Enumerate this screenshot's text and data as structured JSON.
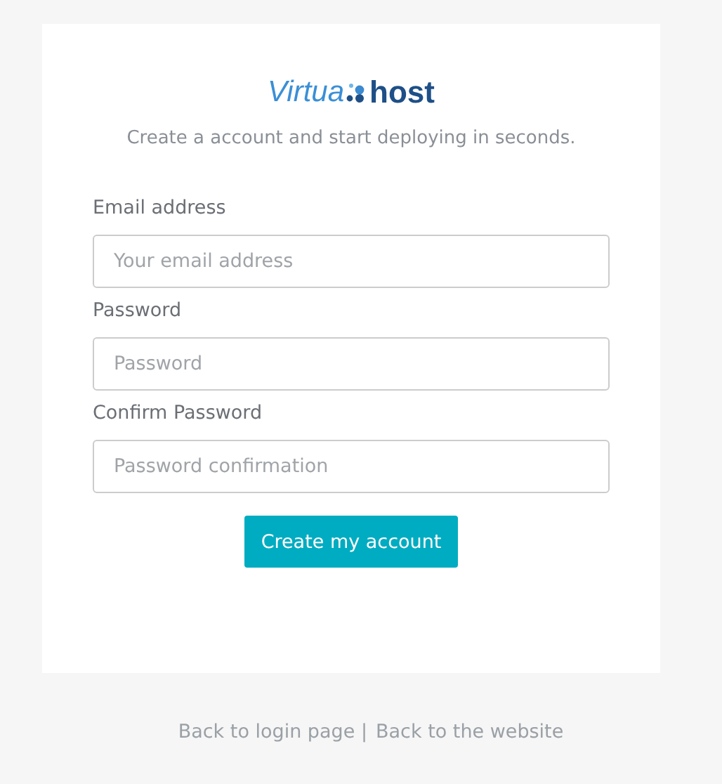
{
  "logo": {
    "part_1": "Virtua",
    "part_2": "host"
  },
  "tagline": "Create a account and start deploying in seconds.",
  "fields": [
    {
      "label": "Email address",
      "placeholder": "Your email address"
    },
    {
      "label": "Password",
      "placeholder": "Password"
    },
    {
      "label": "Confirm Password",
      "placeholder": "Password confirmation"
    }
  ],
  "submit": "Create my account",
  "footer_links": [
    "Back to login page |",
    "Back to the website"
  ]
}
